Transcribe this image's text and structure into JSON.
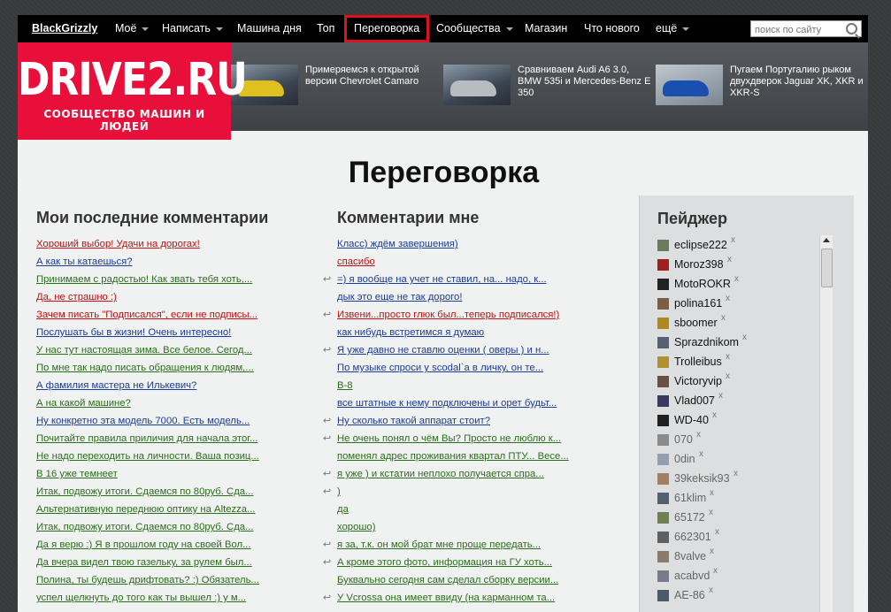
{
  "nav": {
    "user": "BlackGrizzly",
    "items": [
      "Моё",
      "Написать",
      "Машина дня",
      "Топ",
      "Переговорка",
      "Сообщества",
      "Магазин",
      "Что нового",
      "ещё"
    ],
    "search_placeholder": "поиск по сайту"
  },
  "logo": {
    "title": "DRIVE2.RU",
    "tagline": "СООБЩЕСТВО МАШИН И ЛЮДЕЙ",
    "brand_color": "#e8103a"
  },
  "promos": [
    {
      "text": "Примеряемся к открытой версии Chevrolet Camaro"
    },
    {
      "text": "Сравниваем Audi A6 3.0, BMW 535i и Mercedes-Benz E 350"
    },
    {
      "text": "Пугаем Португалию рыком двухдверок Jaguar XK, XKR и XKR-S"
    }
  ],
  "page_title": "Переговорка",
  "my_comments": {
    "heading": "Мои последние комментарии",
    "items": [
      {
        "text": "Хороший выбор! Удачи на дорогах!",
        "color": "red"
      },
      {
        "text": "А как ты катаешься?",
        "color": "blue"
      },
      {
        "text": "Принимаем с радостью! Как звать тебя хоть,...",
        "color": "green"
      },
      {
        "text": "Да, не страшно :)",
        "color": "red"
      },
      {
        "text": "Зачем писать \"Подписался\", если не подписы...",
        "color": "red"
      },
      {
        "text": "Послушать бы в жизни! Очень интересно!",
        "color": "blue"
      },
      {
        "text": "У нас тут настоящая зима. Все белое. Сегод...",
        "color": "green"
      },
      {
        "text": "По мне так надо писать обращения к людям,...",
        "color": "green"
      },
      {
        "text": "А фамилия мастера не Илькевич?",
        "color": "blue"
      },
      {
        "text": "А на какой машине?",
        "color": "green"
      },
      {
        "text": "Ну конкретно эта модель 7000. Есть модель...",
        "color": "blue"
      },
      {
        "text": "Почитайте правила приличия для начала этог...",
        "color": "green"
      },
      {
        "text": "Не надо переходить на личности. Ваша позиц...",
        "color": "green"
      },
      {
        "text": "В 16 уже темнеет",
        "color": "green",
        "strike": true
      },
      {
        "text": "Итак, подвожу итоги. Сдаемся по 80руб. Сда...",
        "color": "green"
      },
      {
        "text": "Альтернативную переднюю оптику на Altezza...",
        "color": "green"
      },
      {
        "text": "Итак, подвожу итоги. Сдаемся по 80руб. Сда...",
        "color": "green",
        "strike": true
      },
      {
        "text": "Да я верю :) Я в прошлом году на своей Вол...",
        "color": "green"
      },
      {
        "text": "Да вчера видел твою газельку, за рулем был...",
        "color": "green"
      },
      {
        "text": "Полина, ты будешь дрифтовать? :) Обязатель...",
        "color": "green"
      },
      {
        "text": "успел щелкнуть до того как ты вышел :) у м...",
        "color": "green"
      }
    ]
  },
  "comments_to_me": {
    "heading": "Комментарии мне",
    "items": [
      {
        "text": "Класс) ждём завершения)",
        "color": "blue",
        "reply": false
      },
      {
        "text": "спасибо",
        "color": "red",
        "reply": false
      },
      {
        "text": "=) я вообще на учет не ставил, на... надо, к...",
        "color": "blue",
        "reply": true
      },
      {
        "text": "дык это еще не так дорого!",
        "color": "blue",
        "reply": false
      },
      {
        "text": "Извени...просто глюк был...теперь подписался!)",
        "color": "red",
        "reply": true
      },
      {
        "text": "как нибудь встретимся я думаю",
        "color": "blue",
        "reply": false
      },
      {
        "text": "Я уже давно не ставлю оценки ( оверы ) и н...",
        "color": "blue",
        "reply": true
      },
      {
        "text": "По музыке спроси у scodal`a в личку, он те...",
        "color": "blue",
        "reply": false
      },
      {
        "text": "В-8",
        "color": "green",
        "reply": false
      },
      {
        "text": "все штатные к нему подключены и орет будьт...",
        "color": "blue",
        "reply": false
      },
      {
        "text": "Ну сколько такой аппарат стоит?",
        "color": "blue",
        "reply": true
      },
      {
        "text": "Не очень понял о чём Вы? Просто не люблю к...",
        "color": "green",
        "reply": true
      },
      {
        "text": "поменял адрес проживания квартал ПТУ... Весе...",
        "color": "green",
        "reply": false
      },
      {
        "text": "я уже ) и кстатии неплохо получается спра...",
        "color": "green",
        "reply": true
      },
      {
        "text": ")",
        "color": "green",
        "reply": true
      },
      {
        "text": "да",
        "color": "green",
        "reply": false
      },
      {
        "text": "хорошо)",
        "color": "green",
        "reply": false
      },
      {
        "text": "я за, т.к. он мой брат мне проще передать...",
        "color": "green",
        "reply": true
      },
      {
        "text": "А кроме этого фото, информация на ГУ хоть...",
        "color": "green",
        "reply": true
      },
      {
        "text": "Буквально сегодня сам сделал сборку версии...",
        "color": "green",
        "reply": false
      },
      {
        "text": "У Vcrossa она имеет ввиду (на карманном та...",
        "color": "green",
        "reply": true
      }
    ]
  },
  "pager": {
    "heading": "Пейджер",
    "remove_mark": "x",
    "users": [
      {
        "name": "eclipse222",
        "online": true,
        "avatar_color": "#6a7a5a"
      },
      {
        "name": "Moroz398",
        "online": true,
        "avatar_color": "#a02020"
      },
      {
        "name": "MotoROKR",
        "online": true,
        "avatar_color": "#222222"
      },
      {
        "name": "polina161",
        "online": true,
        "avatar_color": "#7a6040"
      },
      {
        "name": "sboomer",
        "online": true,
        "avatar_color": "#b08820"
      },
      {
        "name": "Sprazdnikom",
        "online": true,
        "avatar_color": "#556070"
      },
      {
        "name": "Trolleibus",
        "online": true,
        "avatar_color": "#b09030"
      },
      {
        "name": "Victoryvip",
        "online": true,
        "avatar_color": "#6a5040"
      },
      {
        "name": "Vlad007",
        "online": true,
        "avatar_color": "#3a3a60"
      },
      {
        "name": "WD-40",
        "online": true,
        "avatar_color": "#202020"
      },
      {
        "name": "070",
        "online": false,
        "avatar_color": "#8a8a8a"
      },
      {
        "name": "0din",
        "online": false,
        "avatar_color": "#90a0b0"
      },
      {
        "name": "39keksik93",
        "online": false,
        "avatar_color": "#a08060"
      },
      {
        "name": "61klim",
        "online": false,
        "avatar_color": "#506070"
      },
      {
        "name": "65172",
        "online": false,
        "avatar_color": "#708050"
      },
      {
        "name": "662301",
        "online": false,
        "avatar_color": "#606060"
      },
      {
        "name": "8valve",
        "online": false,
        "avatar_color": "#8a7a6a"
      },
      {
        "name": "acabvd",
        "online": false,
        "avatar_color": "#7a7a8a"
      },
      {
        "name": "AE-86",
        "online": false,
        "avatar_color": "#4a5a6a"
      }
    ]
  }
}
